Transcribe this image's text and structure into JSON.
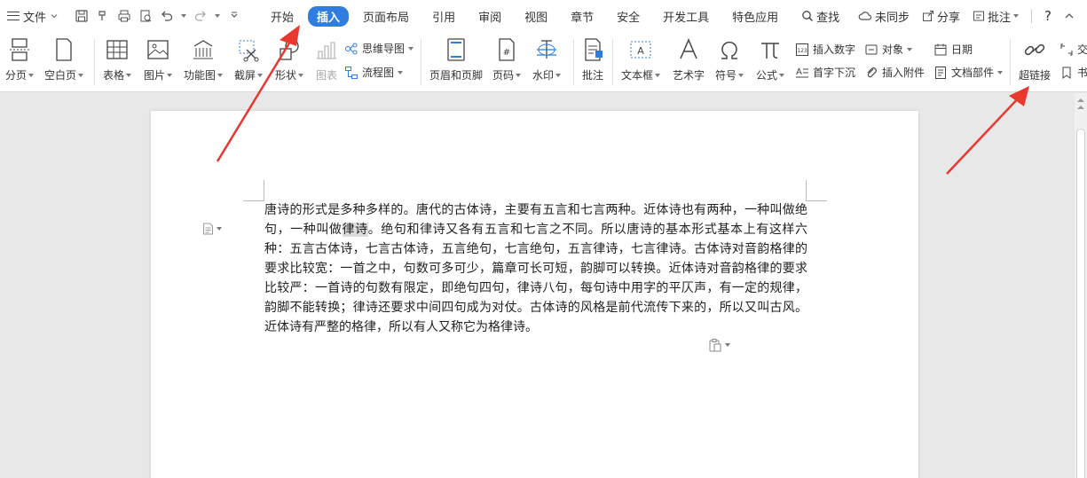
{
  "menubar": {
    "file_label": "文件",
    "tabs": [
      {
        "label": "开始"
      },
      {
        "label": "插入"
      },
      {
        "label": "页面布局"
      },
      {
        "label": "引用"
      },
      {
        "label": "审阅"
      },
      {
        "label": "视图"
      },
      {
        "label": "章节"
      },
      {
        "label": "安全"
      },
      {
        "label": "开发工具"
      },
      {
        "label": "特色应用"
      }
    ],
    "search_label": "查找",
    "sync_label": "未同步",
    "share_label": "分享",
    "comment_label": "批注",
    "help_label": "?",
    "accent_color": "#2f7de1"
  },
  "ribbon": {
    "page_break": "分页",
    "blank_page": "空白页",
    "table": "表格",
    "picture": "图片",
    "function_chart": "功能图",
    "screenshot": "截屏",
    "shape": "形状",
    "chart": "图表",
    "mindmap": "思维导图",
    "flowchart": "流程图",
    "header_footer": "页眉和页脚",
    "page_number": "页码",
    "watermark": "水印",
    "comment": "批注",
    "textbox": "文本框",
    "wordart": "艺术字",
    "symbol": "符号",
    "formula": "公式",
    "insert_number": "插入数字",
    "object": "对象",
    "date": "日期",
    "drop_cap": "首字下沉",
    "insert_attachment": "插入附件",
    "doc_parts": "文档部件",
    "hyperlink": "超链接",
    "cross_ref": "交",
    "bookmark": "书"
  },
  "document": {
    "text_before": "唐诗的形式是多种多样的。唐代的古体诗，主要有五言和七言两种。近体诗也有两种，一种叫做绝句，一种叫做",
    "text_selected": "律诗",
    "text_after": "。绝句和律诗又各有五言和七言之不同。所以唐诗的基本形式基本上有这样六种：五言古体诗，七言古体诗，五言绝句，七言绝句，五言律诗，七言律诗。古体诗对音韵格律的要求比较宽：一首之中，句数可多可少，篇章可长可短，韵脚可以转换。近体诗对音韵格律的要求比较严：一首诗的句数有限定，即绝句四句，律诗八句，每句诗中用字的平仄声，有一定的规律，韵脚不能转换；律诗还要求中间四句成为对仗。古体诗的风格是前代流传下来的，所以又叫古风。近体诗有严整的格律，所以有人又称它为格律诗。"
  }
}
